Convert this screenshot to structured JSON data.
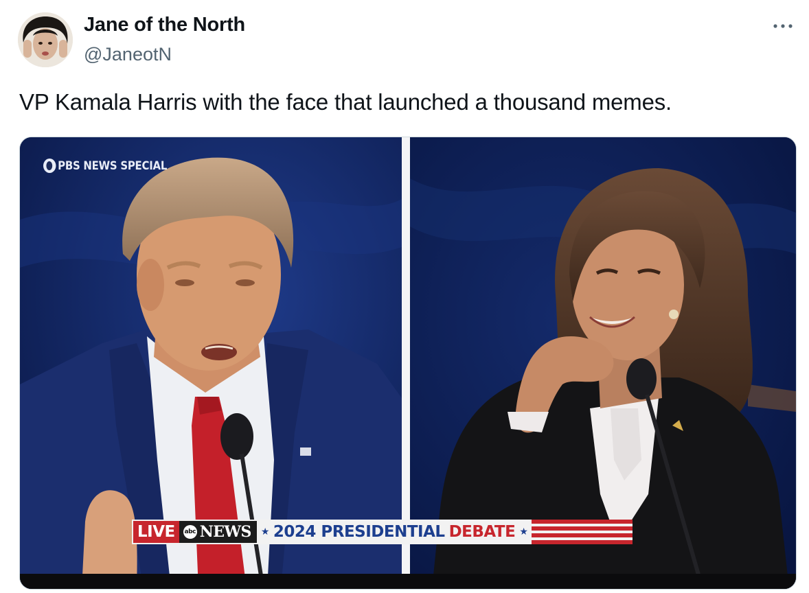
{
  "tweet": {
    "author": {
      "display_name": "Jane of the North",
      "handle": "@JaneotN"
    },
    "text": "VP Kamala Harris with the face that launched a thousand memes.",
    "more_icon": "more-horizontal-icon"
  },
  "media": {
    "overlay_label": "PBS NEWS SPECIAL",
    "chyron": {
      "live": "LIVE",
      "network": "NEWS",
      "network_logo": "abc",
      "title_part1": "2024 PRESIDENTIAL",
      "title_part2": "DEBATE"
    },
    "colors": {
      "chyron_red": "#c7262d",
      "chyron_blue": "#1d3f8f"
    }
  }
}
